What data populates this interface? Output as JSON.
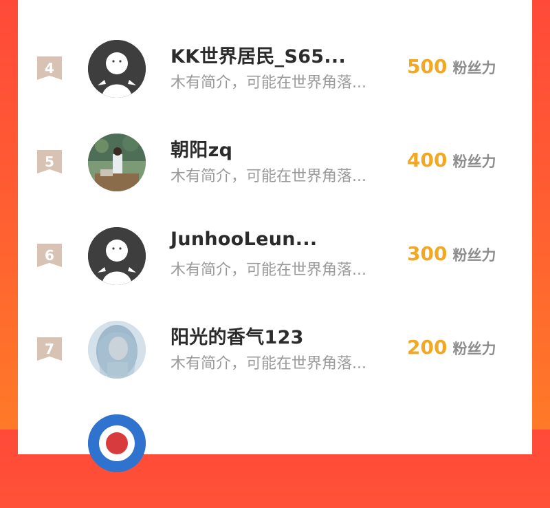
{
  "fans_label": "粉丝力",
  "rows": [
    {
      "rank": "4",
      "name": "KK世界居民_S65...",
      "bio": "木有简介，可能在世界角落...",
      "fans": "500",
      "avatar": "default-avatar"
    },
    {
      "rank": "5",
      "name": "朝阳zq",
      "bio": "木有简介，可能在世界角落...",
      "fans": "400",
      "avatar": "photo-avatar"
    },
    {
      "rank": "6",
      "name": "JunhooLeun...",
      "bio": "木有简介，可能在世界角落...",
      "fans": "300",
      "avatar": "default-avatar"
    },
    {
      "rank": "7",
      "name": "阳光的香气123",
      "bio": "木有简介，可能在世界角落...",
      "fans": "200",
      "avatar": "photo-avatar"
    },
    {
      "rank": "",
      "name": "",
      "bio": "",
      "fans": "",
      "avatar": "photo-avatar"
    }
  ],
  "colors": {
    "accent": "#f2a824",
    "rank_badge": "#d7c2b3",
    "background_top": "#ff4a3a",
    "background_bottom": "#ff7a28"
  }
}
